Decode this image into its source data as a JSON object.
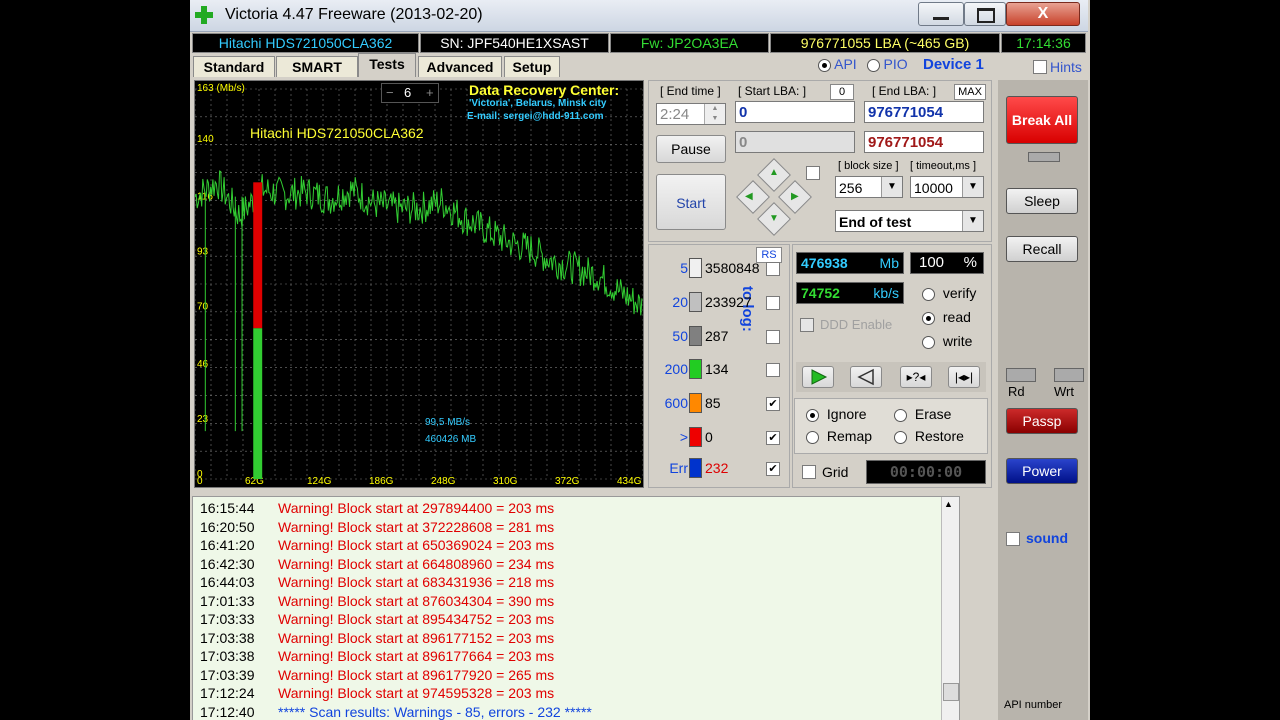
{
  "window": {
    "title": "Victoria 4.47  Freeware (2013-02-20)",
    "controls": {
      "minimize": "—",
      "maximize": "□",
      "close": "X"
    }
  },
  "info_bar": {
    "model": "Hitachi HDS721050CLA362",
    "serial": "SN: JPF540HE1XSAST",
    "firmware": "Fw: JP2OA3EA",
    "lba": "976771055 LBA (~465 GB)",
    "time": "17:14:36"
  },
  "tabs": [
    {
      "label": "Standard",
      "active": false
    },
    {
      "label": "SMART",
      "active": false
    },
    {
      "label": "Tests",
      "active": true
    },
    {
      "label": "Advanced",
      "active": false
    },
    {
      "label": "Setup",
      "active": false
    }
  ],
  "mode": {
    "api_label": "API",
    "pio_label": "PIO",
    "selected": "API",
    "device_label": "Device 1",
    "hints_label": "Hints"
  },
  "chart": {
    "y_ticks": [
      "163 (Mb/s)",
      "140",
      "116",
      "93",
      "70",
      "46",
      "23",
      "0"
    ],
    "x_ticks": [
      "62G",
      "124G",
      "186G",
      "248G",
      "310G",
      "372G",
      "434G"
    ],
    "spin_value": "6",
    "drive_label": "Hitachi HDS721050CLA362",
    "promo_title": "Data Recovery Center:",
    "promo_line2": "'Victoria', Belarus, Minsk city",
    "promo_line3": "E-mail: sergei@hdd-911.com",
    "speed_readout": "99,5 MB/s",
    "pos_readout": "460426 MB",
    "colors": {
      "line": "#32cd32",
      "bad_block": "#e00000",
      "grid": "#7a7a7a",
      "labels": "#ffff00",
      "readout": "#33ccff"
    }
  },
  "chart_data": {
    "type": "line",
    "series": [
      {
        "name": "",
        "x": [
          0,
          5,
          10,
          15,
          20,
          25,
          30,
          35,
          40,
          45,
          50,
          55,
          60,
          65,
          70,
          75,
          80,
          85,
          90,
          95,
          100
        ],
        "values": [
          118,
          124,
          110,
          121,
          119,
          120,
          117,
          121,
          115,
          113,
          113,
          116,
          109,
          104,
          99,
          96,
          91,
          88,
          85,
          78,
          72
        ]
      }
    ],
    "bad_region": {
      "from": 13,
      "to": 15,
      "unit": "percent"
    },
    "xlabel": "",
    "ylabel": "Mb/s",
    "ylim": [
      0,
      163
    ]
  },
  "lba": {
    "end_time_label": "[ End time ]",
    "end_time_value": "2:24",
    "start_lba_label": "[ Start LBA: ]",
    "start_lba_zero": "0",
    "start_lba_value": "0",
    "end_lba_label": "[ End LBA: ]",
    "end_lba_max": "MAX",
    "end_lba_value": "976771054",
    "current_lba_value": "0",
    "current_end_value": "976771054",
    "pause_label": "Pause",
    "start_label": "Start",
    "block_size_label": "[ block size ]",
    "block_size_value": "256",
    "timeout_label": "[ timeout,ms ]",
    "timeout_value": "10000",
    "end_action_value": "End of test"
  },
  "counters": {
    "rs_label": "RS",
    "to_log_label": "to log:",
    "rows": [
      {
        "label": "5",
        "value": "3580848",
        "color": "#f0f0f0",
        "checked": false
      },
      {
        "label": "20",
        "value": "233927",
        "color": "#c0c0c0",
        "checked": false
      },
      {
        "label": "50",
        "value": "287",
        "color": "#808080",
        "checked": false
      },
      {
        "label": "200",
        "value": "134",
        "color": "#22cc22",
        "checked": false
      },
      {
        "label": "600",
        "value": "85",
        "color": "#ff8800",
        "checked": true
      },
      {
        "label": ">",
        "value": "0",
        "color": "#ee0000",
        "checked": true
      },
      {
        "label": "Err",
        "value": "232",
        "color": "#0033cc",
        "checked": true
      }
    ]
  },
  "progress": {
    "mb_value": "476938",
    "mb_unit": "Mb",
    "percent_value": "100",
    "percent_unit": "%",
    "speed_value": "74752",
    "speed_unit": "kb/s",
    "ddd_label": "DDD Enable",
    "verify_label": "verify",
    "read_label": "read",
    "write_label": "write",
    "selected_mode": "read"
  },
  "actions": {
    "ignore_label": "Ignore",
    "erase_label": "Erase",
    "remap_label": "Remap",
    "restore_label": "Restore",
    "selected": "Ignore",
    "grid_label": "Grid",
    "timer": "00:00:00"
  },
  "side": {
    "break_all": "Break All",
    "sleep": "Sleep",
    "recall": "Recall",
    "rd": "Rd",
    "wrt": "Wrt",
    "passp": "Passp",
    "power": "Power",
    "sound": "sound",
    "api_number": "API number"
  },
  "log": [
    {
      "time": "16:15:44",
      "msg": "Warning! Block start at 297894400 = 203 ms",
      "kind": "warn"
    },
    {
      "time": "16:20:50",
      "msg": "Warning! Block start at 372228608 = 281 ms",
      "kind": "warn"
    },
    {
      "time": "16:41:20",
      "msg": "Warning! Block start at 650369024 = 203 ms",
      "kind": "warn"
    },
    {
      "time": "16:42:30",
      "msg": "Warning! Block start at 664808960 = 234 ms",
      "kind": "warn"
    },
    {
      "time": "16:44:03",
      "msg": "Warning! Block start at 683431936 = 218 ms",
      "kind": "warn"
    },
    {
      "time": "17:01:33",
      "msg": "Warning! Block start at 876034304 = 390 ms",
      "kind": "warn"
    },
    {
      "time": "17:03:33",
      "msg": "Warning! Block start at 895434752 = 203 ms",
      "kind": "warn"
    },
    {
      "time": "17:03:38",
      "msg": "Warning! Block start at 896177152 = 203 ms",
      "kind": "warn"
    },
    {
      "time": "17:03:38",
      "msg": "Warning! Block start at 896177664 = 203 ms",
      "kind": "warn"
    },
    {
      "time": "17:03:39",
      "msg": "Warning! Block start at 896177920 = 265 ms",
      "kind": "warn"
    },
    {
      "time": "17:12:24",
      "msg": "Warning! Block start at 974595328 = 203 ms",
      "kind": "warn"
    },
    {
      "time": "17:12:40",
      "msg": "***** Scan results: Warnings - 85, errors - 232 *****",
      "kind": "info"
    }
  ]
}
